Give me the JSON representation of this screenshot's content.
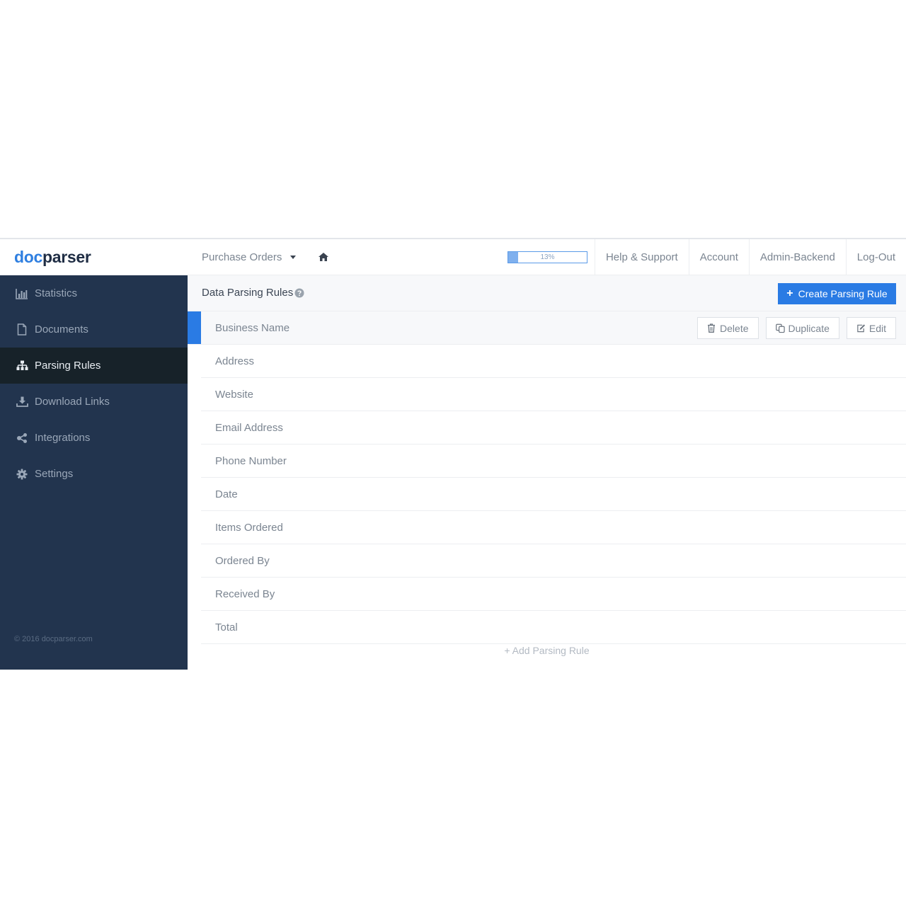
{
  "brand": {
    "logo_part1": "doc",
    "logo_part2": "parser"
  },
  "header": {
    "project": "Purchase Orders",
    "usage": {
      "label": "13%",
      "fraction": 0.13
    },
    "nav": [
      "Help & Support",
      "Account",
      "Admin-Backend",
      "Log-Out"
    ]
  },
  "sidebar": {
    "items": [
      {
        "label": "Statistics",
        "icon": "bar-chart-icon",
        "active": false
      },
      {
        "label": "Documents",
        "icon": "document-icon",
        "active": false
      },
      {
        "label": "Parsing Rules",
        "icon": "sitemap-icon",
        "active": true
      },
      {
        "label": "Download Links",
        "icon": "download-icon",
        "active": false
      },
      {
        "label": "Integrations",
        "icon": "share-icon",
        "active": false
      },
      {
        "label": "Settings",
        "icon": "gear-icon",
        "active": false
      }
    ],
    "copyright": "© 2016 docparser.com"
  },
  "main": {
    "title": "Data Parsing Rules",
    "create_label": "Create Parsing Rule",
    "actions": {
      "delete": "Delete",
      "duplicate": "Duplicate",
      "edit": "Edit"
    },
    "rules": [
      "Business Name",
      "Address",
      "Website",
      "Email Address",
      "Phone Number",
      "Date",
      "Items Ordered",
      "Ordered By",
      "Received By",
      "Total"
    ],
    "add_label": "+ Add Parsing Rule"
  },
  "colors": {
    "accent": "#2a7be4",
    "sidebar": "#22344e",
    "sidebar_active": "#172229"
  }
}
